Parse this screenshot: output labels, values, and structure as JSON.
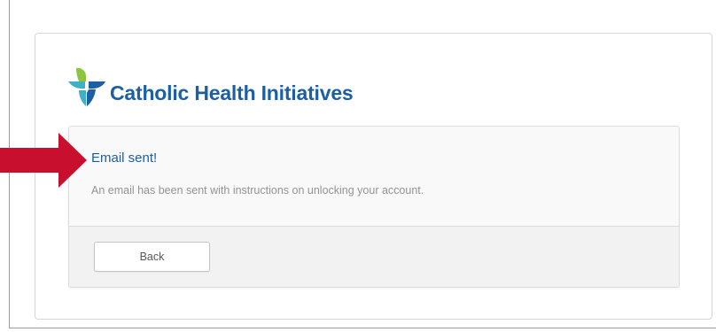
{
  "brand": {
    "name": "Catholic Health Initiatives",
    "logo_icon": "chi-cross-logo-icon",
    "colors": {
      "primary_blue": "#1c5fa3",
      "teal": "#3fb1c6",
      "green": "#8cc63f",
      "arrow_red": "#c8102e"
    }
  },
  "notice": {
    "heading": "Email sent!",
    "message": "An email has been sent with instructions on unlocking your account."
  },
  "actions": {
    "back_label": "Back"
  },
  "annotation": {
    "icon": "red-arrow-icon"
  }
}
